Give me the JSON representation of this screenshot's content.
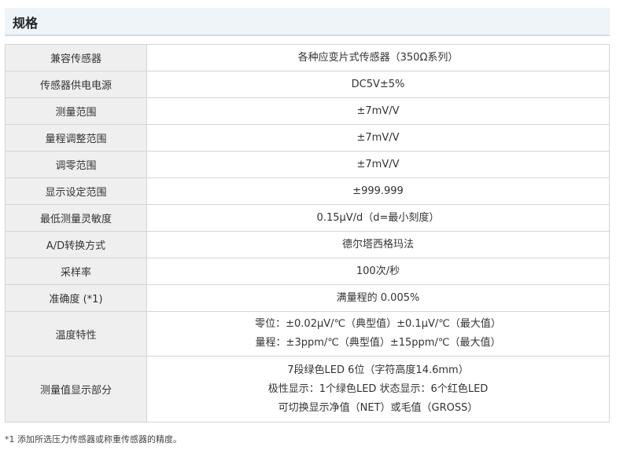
{
  "section": {
    "title": "规格"
  },
  "rows": [
    {
      "label": "兼容传感器",
      "value": [
        "各种应变片式传感器（350Ω系列）"
      ]
    },
    {
      "label": "传感器供电电源",
      "value": [
        "DC5V±5%"
      ]
    },
    {
      "label": "测量范围",
      "value": [
        "±7mV/V"
      ]
    },
    {
      "label": "量程调整范围",
      "value": [
        "±7mV/V"
      ]
    },
    {
      "label": "调零范围",
      "value": [
        "±7mV/V"
      ]
    },
    {
      "label": "显示设定范围",
      "value": [
        "±999.999"
      ]
    },
    {
      "label": "最低测量灵敏度",
      "value": [
        "0.15μV/d（d=最小刻度）"
      ]
    },
    {
      "label": "A/D转换方式",
      "value": [
        "德尔塔西格玛法"
      ]
    },
    {
      "label": "采样率",
      "value": [
        "100次/秒"
      ]
    },
    {
      "label": "准确度 (*1)",
      "value": [
        "满量程的 0.005%"
      ]
    },
    {
      "label": "温度特性",
      "value": [
        "零位：±0.02μV/℃（典型值）±0.1μV/℃（最大值）",
        "量程：±3ppm/℃（典型值）±15ppm/℃（最大值）"
      ]
    },
    {
      "label": "测量值显示部分",
      "value": [
        "7段绿色LED 6位（字符高度14.6mm）",
        "极性显示：1个绿色LED 状态显示：6个红色LED",
        "可切换显示净值（NET）或毛值（GROSS）"
      ]
    }
  ],
  "footnote": "*1 添加所选压力传感器或称重传感器的精度。"
}
